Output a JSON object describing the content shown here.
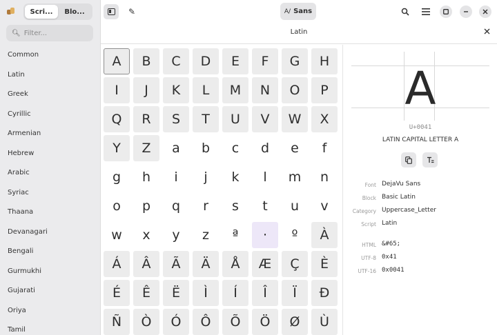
{
  "sidebar": {
    "tabs": [
      {
        "label": "Scri...",
        "active": true
      },
      {
        "label": "Blo...",
        "active": false
      }
    ],
    "search_placeholder": "Filter...",
    "scripts": [
      "Common",
      "Latin",
      "Greek",
      "Cyrillic",
      "Armenian",
      "Hebrew",
      "Arabic",
      "Syriac",
      "Thaana",
      "Devanagari",
      "Bengali",
      "Gurmukhi",
      "Gujarati",
      "Oriya",
      "Tamil"
    ]
  },
  "header": {
    "font_button_label": "Sans",
    "font_button_prefix": "A/",
    "subtitle": "Latin"
  },
  "grid": {
    "rows": [
      [
        "A",
        "B",
        "C",
        "D",
        "E",
        "F",
        "G",
        "H"
      ],
      [
        "I",
        "J",
        "K",
        "L",
        "M",
        "N",
        "O",
        "P"
      ],
      [
        "Q",
        "R",
        "S",
        "T",
        "U",
        "V",
        "W",
        "X"
      ],
      [
        "Y",
        "Z",
        "a",
        "b",
        "c",
        "d",
        "e",
        "f"
      ],
      [
        "g",
        "h",
        "i",
        "j",
        "k",
        "l",
        "m",
        "n"
      ],
      [
        "o",
        "p",
        "q",
        "r",
        "s",
        "t",
        "u",
        "v"
      ],
      [
        "w",
        "x",
        "y",
        "z",
        "ª",
        "·",
        "º",
        "À"
      ],
      [
        "Á",
        "Â",
        "Ã",
        "Ä",
        "Å",
        "Æ",
        "Ç",
        "È"
      ],
      [
        "É",
        "Ê",
        "Ë",
        "Ì",
        "Í",
        "Î",
        "Ï",
        "Ð"
      ],
      [
        "Ñ",
        "Ò",
        "Ó",
        "Ô",
        "Õ",
        "Ö",
        "Ø",
        "Ù"
      ]
    ],
    "selected": "A",
    "highlighted": "·",
    "shaded": [
      "A",
      "B",
      "C",
      "D",
      "E",
      "F",
      "G",
      "H",
      "I",
      "J",
      "K",
      "L",
      "M",
      "N",
      "O",
      "P",
      "Q",
      "R",
      "S",
      "T",
      "U",
      "V",
      "W",
      "X",
      "Y",
      "Z",
      "À",
      "Á",
      "Â",
      "Ã",
      "Ä",
      "Å",
      "Æ",
      "Ç",
      "È",
      "É",
      "Ê",
      "Ë",
      "Ì",
      "Í",
      "Î",
      "Ï",
      "Ð",
      "Ñ",
      "Ò",
      "Ó",
      "Ô",
      "Õ",
      "Ö",
      "Ø",
      "Ù"
    ]
  },
  "detail": {
    "glyph": "A",
    "codepoint": "U+0041",
    "name": "LATIN CAPITAL LETTER A",
    "properties": [
      {
        "label": "Font",
        "value": "DejaVu Sans",
        "mono": false
      },
      {
        "label": "Block",
        "value": "Basic Latin",
        "mono": false
      },
      {
        "label": "Category",
        "value": "Uppercase_Letter",
        "mono": false
      },
      {
        "label": "Script",
        "value": "Latin",
        "mono": false
      },
      {
        "label": "HTML",
        "value": "&#65;",
        "mono": true
      },
      {
        "label": "UTF-8",
        "value": "0x41",
        "mono": true
      },
      {
        "label": "UTF-16",
        "value": "0x0041",
        "mono": true
      }
    ]
  },
  "icons": {
    "search": "search-icon",
    "menu": "hamburger-menu-icon",
    "maximize": "maximize-icon",
    "minimize": "minimize-icon",
    "close": "close-icon",
    "edit": "pencil-icon",
    "sidebar_toggle": "sidebar-toggle-icon",
    "copy": "copy-icon",
    "text": "text-tool-icon"
  },
  "colors": {
    "accent_highlight": "#ede7f8",
    "sidebar_bg": "#ebebed",
    "cell_bg": "#ececec"
  }
}
